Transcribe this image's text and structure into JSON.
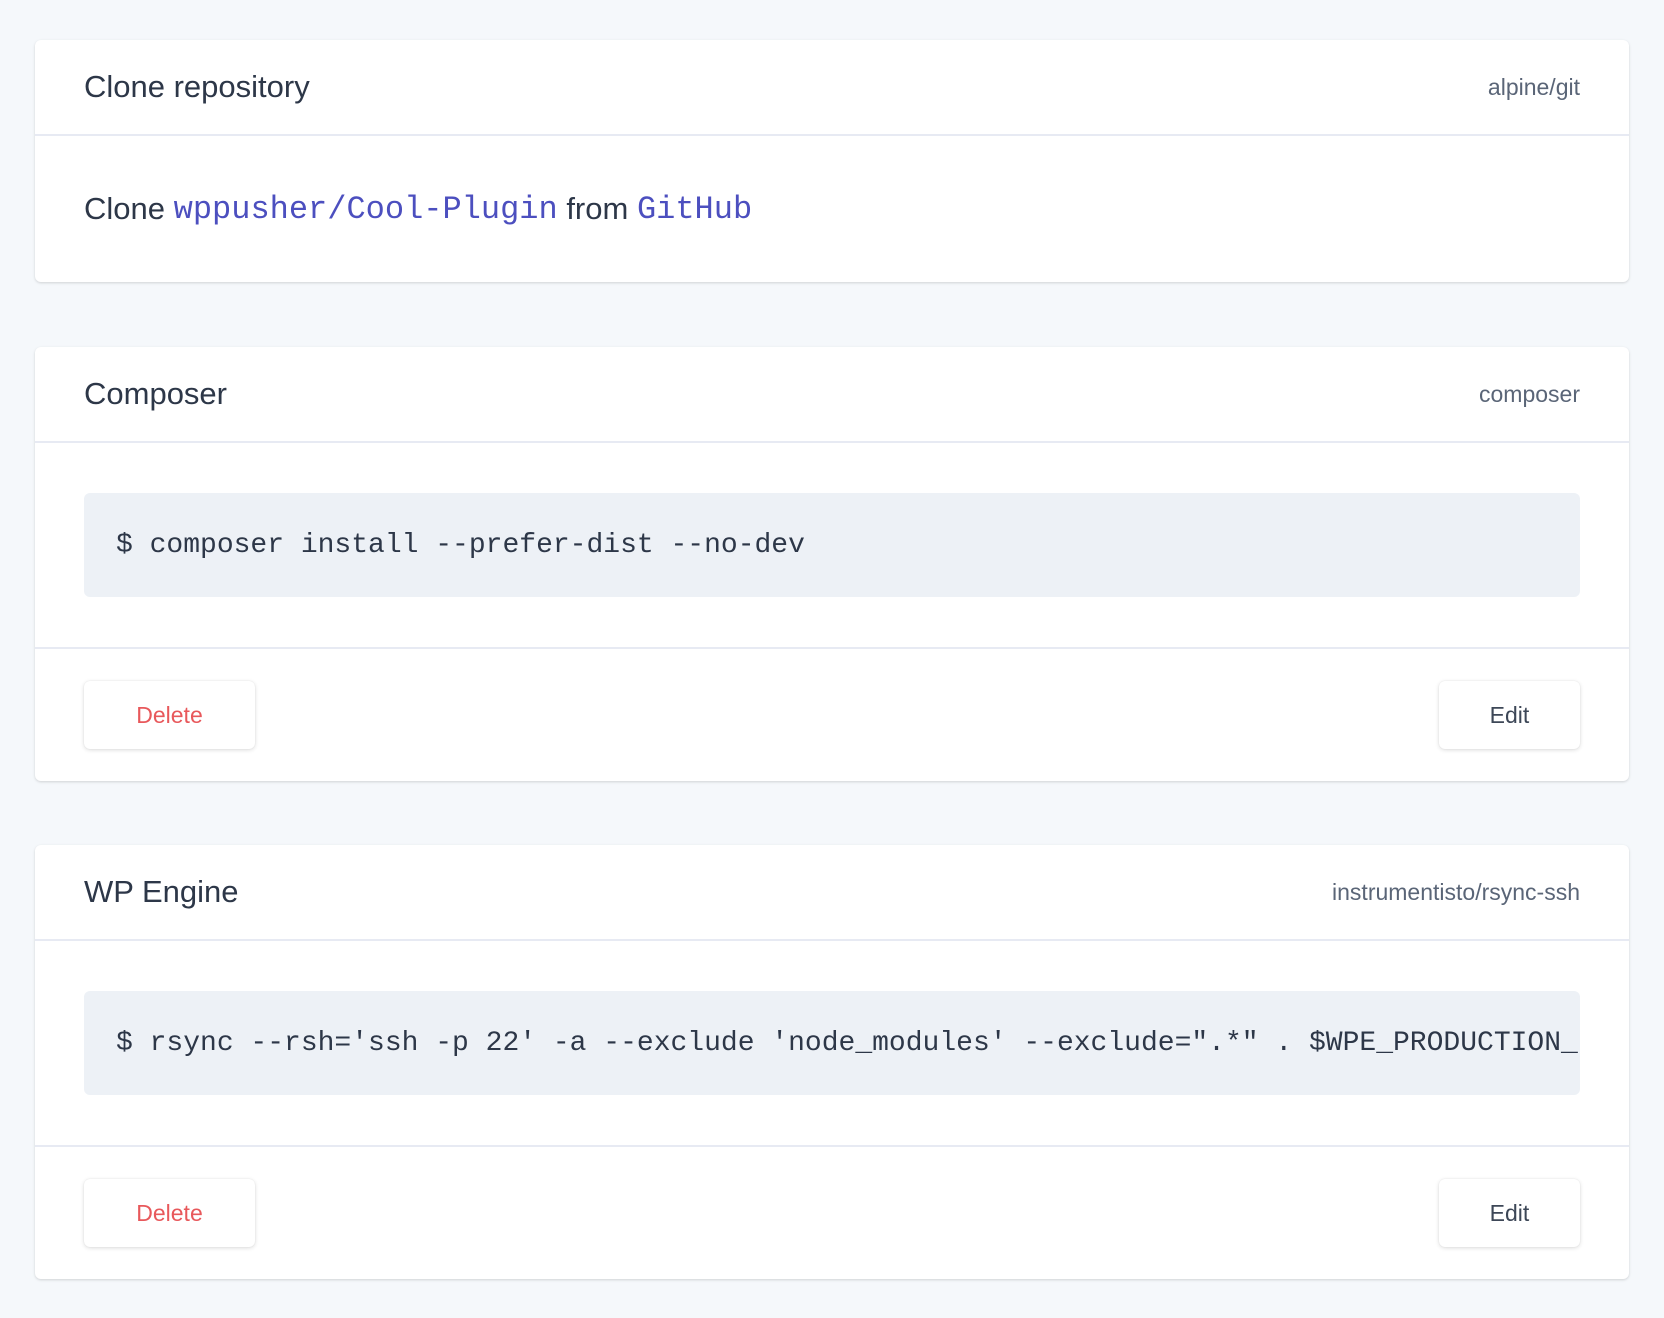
{
  "steps": [
    {
      "title": "Clone repository",
      "image": "alpine/git",
      "description": {
        "prefix": "Clone",
        "repo": "wppusher/Cool-Plugin",
        "middle": "from",
        "provider": "GitHub"
      }
    },
    {
      "title": "Composer",
      "image": "composer",
      "command": "$ composer install --prefer-dist --no-dev",
      "delete_label": "Delete",
      "edit_label": "Edit"
    },
    {
      "title": "WP Engine",
      "image": "instrumentisto/rsync-ssh",
      "command": "$ rsync --rsh='ssh -p 22' -a --exclude 'node_modules' --exclude=\".*\" . $WPE_PRODUCTION_",
      "delete_label": "Delete",
      "edit_label": "Edit"
    }
  ],
  "colors": {
    "background": "#f5f8fb",
    "link": "#4c4fbf",
    "danger": "#e8585b",
    "code_bg": "#edf1f6"
  }
}
